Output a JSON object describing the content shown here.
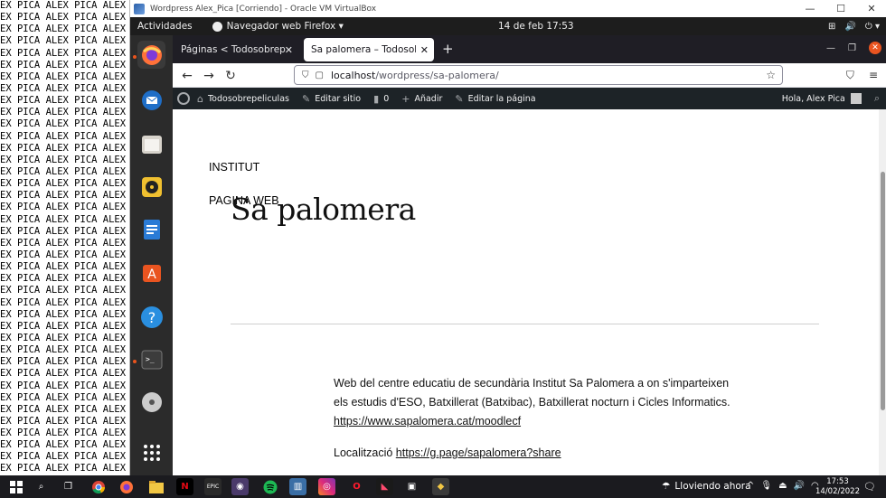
{
  "host": {
    "bg_text_line": "EX PICA ALEX PICA ALEX PICA ALEX PICA",
    "vbox_title": "Wordpress Alex_Pica [Corriendo] - Oracle VM VirtualBox"
  },
  "ubuntu": {
    "activities": "Actividades",
    "app_menu": "Navegador web Firefox ▾",
    "clock": "14 de feb  17:53",
    "tray": [
      "⊞",
      "🔊",
      "⏻ ▾"
    ]
  },
  "firefox": {
    "tabs": [
      {
        "label": "Páginas < Todosobrepelículas",
        "close": "✕"
      },
      {
        "label": "Sa palomera – Todosobrepelículas",
        "close": "✕"
      }
    ],
    "new_tab": "+",
    "url_host": "localhost",
    "url_path": "/wordpress/sa-palomera/"
  },
  "wp_admin_bar": {
    "site_name": "Todosobrepeliculas",
    "edit_site": "Editar sitio",
    "comments_count": "0",
    "add_new": "Añadir",
    "edit_page": "Editar la página",
    "greeting": "Hola, Alex Pica"
  },
  "page": {
    "menu": [
      "INSTITUT",
      "PAGINA WEB"
    ],
    "title": "Sa palomera",
    "paragraph": "Web del centre educatiu de secundària Institut Sa Palomera a on s'imparteixen els estudis d'ESO, Batxillerat (Batxibac), Batxillerat nocturn i Cicles Informatics.",
    "paragraph_link": "https://www.sapalomera.cat/moodlecf",
    "location_label": "Localització ",
    "location_link": "https://g.page/sapalomera?share"
  },
  "taskbar": {
    "weather": "Lloviendo ahora",
    "time": "17:53",
    "date": "14/02/2022"
  },
  "colors": {
    "ubuntu_orange": "#e95420",
    "wp_bar": "#1d2327",
    "ff_tabbar": "#1f1e25"
  }
}
